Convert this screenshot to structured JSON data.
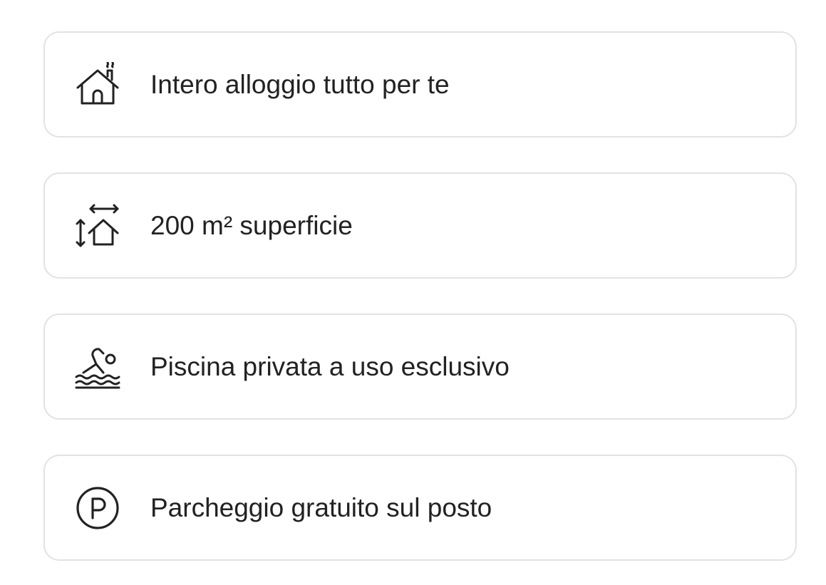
{
  "features": [
    {
      "icon": "house-with-chimney-icon",
      "label": "Intero alloggio tutto per te"
    },
    {
      "icon": "floor-area-icon",
      "label": "200 m² superficie"
    },
    {
      "icon": "swimmer-pool-icon",
      "label": "Piscina privata a uso esclusivo"
    },
    {
      "icon": "parking-icon",
      "label": "Parcheggio gratuito sul posto"
    }
  ],
  "colors": {
    "text": "#222222",
    "border": "#e2e2e2",
    "background": "#ffffff"
  }
}
